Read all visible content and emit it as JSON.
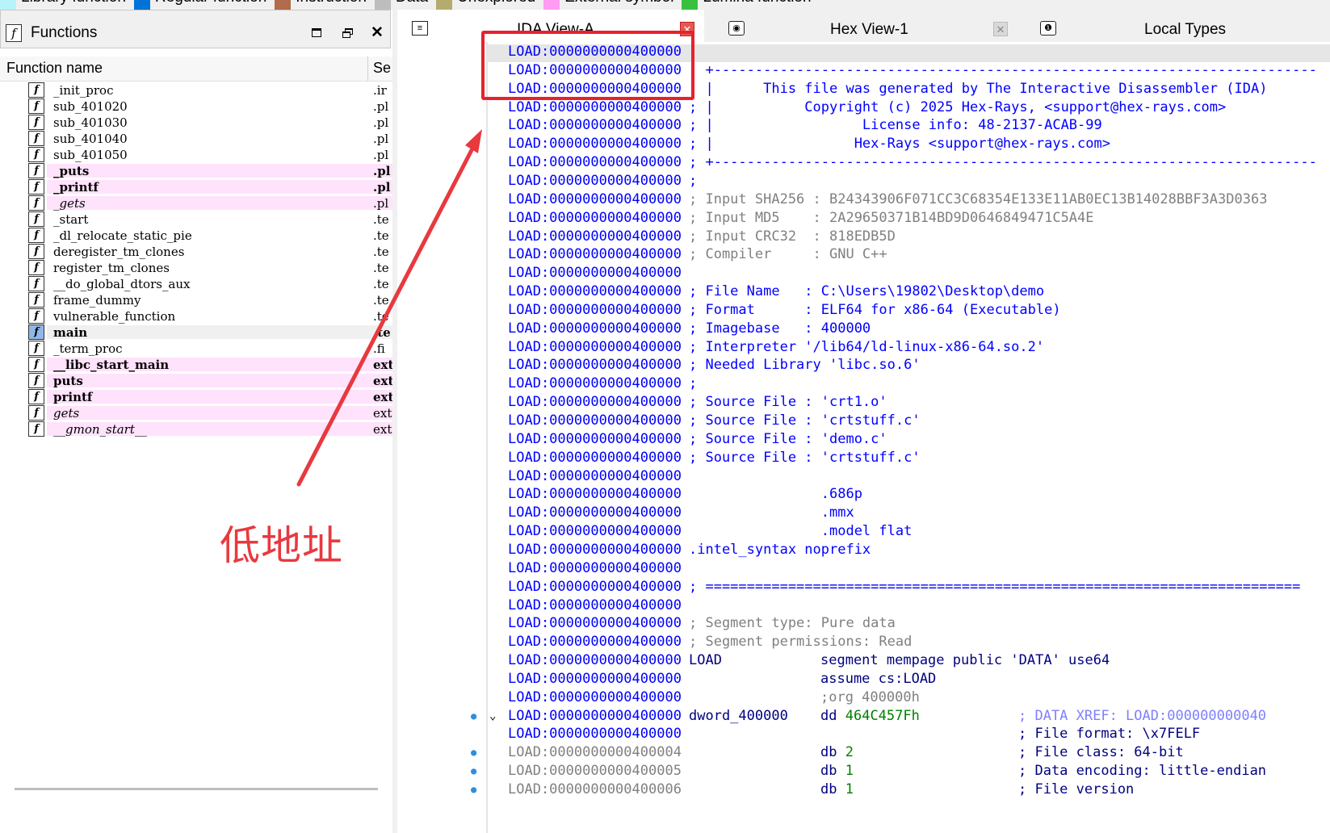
{
  "legend": {
    "items": [
      {
        "label": "Library function",
        "color": "#b7f3f8"
      },
      {
        "label": "Regular function",
        "color": "#0073d8"
      },
      {
        "label": "Instruction",
        "color": "#b06c4c"
      },
      {
        "label": "Data",
        "color": "#bdbdbd"
      },
      {
        "label": "Unexplored",
        "color": "#b3ac6e"
      },
      {
        "label": "External symbol",
        "color": "#ff9cf2"
      },
      {
        "label": "Lumina function",
        "color": "#38c13f"
      }
    ]
  },
  "functions_panel": {
    "title": "Functions",
    "icon": "function-icon",
    "col_name": "Function name",
    "col_segment": "Se",
    "rows": [
      {
        "name": "_init_proc",
        "seg": ".ir",
        "style": "normal"
      },
      {
        "name": "sub_401020",
        "seg": ".pl",
        "style": "normal"
      },
      {
        "name": "sub_401030",
        "seg": ".pl",
        "style": "normal"
      },
      {
        "name": "sub_401040",
        "seg": ".pl",
        "style": "normal"
      },
      {
        "name": "sub_401050",
        "seg": ".pl",
        "style": "normal"
      },
      {
        "name": "_puts",
        "seg": ".pl",
        "style": "pink-bold"
      },
      {
        "name": "_printf",
        "seg": ".pl",
        "style": "pink-bold"
      },
      {
        "name": "_gets",
        "seg": ".pl",
        "style": "pink-italic"
      },
      {
        "name": "_start",
        "seg": ".te",
        "style": "normal"
      },
      {
        "name": "_dl_relocate_static_pie",
        "seg": ".te",
        "style": "normal"
      },
      {
        "name": "deregister_tm_clones",
        "seg": ".te",
        "style": "normal"
      },
      {
        "name": "register_tm_clones",
        "seg": ".te",
        "style": "normal"
      },
      {
        "name": "__do_global_dtors_aux",
        "seg": ".te",
        "style": "normal"
      },
      {
        "name": "frame_dummy",
        "seg": ".te",
        "style": "normal"
      },
      {
        "name": "vulnerable_function",
        "seg": ".te",
        "style": "normal"
      },
      {
        "name": "main",
        "seg": ".te",
        "style": "selected-bold"
      },
      {
        "name": "_term_proc",
        "seg": ".fi",
        "style": "normal"
      },
      {
        "name": "__libc_start_main",
        "seg": "ext",
        "style": "pink-bold"
      },
      {
        "name": "puts",
        "seg": "ext",
        "style": "pink-bold"
      },
      {
        "name": "printf",
        "seg": "ext",
        "style": "pink-bold"
      },
      {
        "name": "gets",
        "seg": "ext",
        "style": "pink-italic"
      },
      {
        "name": "__gmon_start__",
        "seg": "ext",
        "style": "pink-italic"
      }
    ]
  },
  "annotation": {
    "text": "低地址",
    "color": "#e8393f"
  },
  "tabs": [
    {
      "label": "IDA View-A",
      "icon": "disasm-icon",
      "active": true
    },
    {
      "label": "Hex View-1",
      "icon": "hex-icon",
      "active": false
    },
    {
      "label": "Local Types",
      "icon": "info-icon",
      "active": false
    }
  ],
  "disasm": {
    "lines": [
      {
        "addr": "LOAD:0000000000400000",
        "text": ""
      },
      {
        "addr": "LOAD:0000000000400000",
        "text": "; +-------------------------------------------------------------------------"
      },
      {
        "addr": "LOAD:0000000000400000",
        "text": "; |      This file was generated by The Interactive Disassembler (IDA)"
      },
      {
        "addr": "LOAD:0000000000400000",
        "text": "; |           Copyright (c) 2025 Hex-Rays, <support@hex-rays.com>"
      },
      {
        "addr": "LOAD:0000000000400000",
        "text": "; |                  License info: 48-2137-ACAB-99"
      },
      {
        "addr": "LOAD:0000000000400000",
        "text": "; |                 Hex-Rays <support@hex-rays.com>"
      },
      {
        "addr": "LOAD:0000000000400000",
        "text": "; +-------------------------------------------------------------------------"
      },
      {
        "addr": "LOAD:0000000000400000",
        "text": ";"
      },
      {
        "addr": "LOAD:0000000000400000",
        "text": "; Input SHA256 : B24343906F071CC3C68354E133E11AB0EC13B14028BBF3A3D0363"
      },
      {
        "addr": "LOAD:0000000000400000",
        "text": "; Input MD5    : 2A29650371B14BD9D0646849471C5A4E"
      },
      {
        "addr": "LOAD:0000000000400000",
        "text": "; Input CRC32  : 818EDB5D"
      },
      {
        "addr": "LOAD:0000000000400000",
        "text": "; Compiler     : GNU C++"
      },
      {
        "addr": "LOAD:0000000000400000",
        "text": ""
      },
      {
        "addr": "LOAD:0000000000400000",
        "text": "; File Name   : C:\\Users\\19802\\Desktop\\demo"
      },
      {
        "addr": "LOAD:0000000000400000",
        "text": "; Format      : ELF64 for x86-64 (Executable)"
      },
      {
        "addr": "LOAD:0000000000400000",
        "text": "; Imagebase   : 400000"
      },
      {
        "addr": "LOAD:0000000000400000",
        "text": "; Interpreter '/lib64/ld-linux-x86-64.so.2'"
      },
      {
        "addr": "LOAD:0000000000400000",
        "text": "; Needed Library 'libc.so.6'"
      },
      {
        "addr": "LOAD:0000000000400000",
        "text": ";"
      },
      {
        "addr": "LOAD:0000000000400000",
        "text": "; Source File : 'crt1.o'"
      },
      {
        "addr": "LOAD:0000000000400000",
        "text": "; Source File : 'crtstuff.c'"
      },
      {
        "addr": "LOAD:0000000000400000",
        "text": "; Source File : 'demo.c'"
      },
      {
        "addr": "LOAD:0000000000400000",
        "text": "; Source File : 'crtstuff.c'"
      },
      {
        "addr": "LOAD:0000000000400000",
        "text": ""
      },
      {
        "addr": "LOAD:0000000000400000",
        "text": "                .686p"
      },
      {
        "addr": "LOAD:0000000000400000",
        "text": "                .mmx"
      },
      {
        "addr": "LOAD:0000000000400000",
        "text": "                .model flat"
      },
      {
        "addr": "LOAD:0000000000400000",
        "text": ".intel_syntax noprefix"
      },
      {
        "addr": "LOAD:0000000000400000",
        "text": ""
      },
      {
        "addr": "LOAD:0000000000400000",
        "text": "; ========================================================================"
      },
      {
        "addr": "LOAD:0000000000400000",
        "text": ""
      },
      {
        "addr": "LOAD:0000000000400000",
        "text": "; Segment type: Pure data"
      },
      {
        "addr": "LOAD:0000000000400000",
        "text": "; Segment permissions: Read"
      },
      {
        "addr": "LOAD:0000000000400000",
        "label": "LOAD",
        "instr": "segment mempage public 'DATA' use64"
      },
      {
        "addr": "LOAD:0000000000400000",
        "instr": "assume cs:LOAD"
      },
      {
        "addr": "LOAD:0000000000400000",
        "instr_gray": ";org 400000h"
      },
      {
        "addr": "LOAD:0000000000400000",
        "label": "dword_400000",
        "op": "dd",
        "num": "464C457Fh",
        "comment": "; DATA XREF: LOAD:000000000040",
        "dot": true,
        "arrow": true
      },
      {
        "addr": "LOAD:0000000000400000",
        "comment": "; File format: \\x7FELF"
      },
      {
        "addr": "LOAD:0000000000400004",
        "op": "db",
        "num": "2",
        "comment": "; File class: 64-bit",
        "dot": true,
        "gray": true
      },
      {
        "addr": "LOAD:0000000000400005",
        "op": "db",
        "num": "1",
        "comment": "; Data encoding: little-endian",
        "dot": true,
        "gray": true
      },
      {
        "addr": "LOAD:0000000000400006",
        "op": "db",
        "num": "1",
        "comment": "; File version",
        "dot": true,
        "gray": true
      }
    ]
  }
}
